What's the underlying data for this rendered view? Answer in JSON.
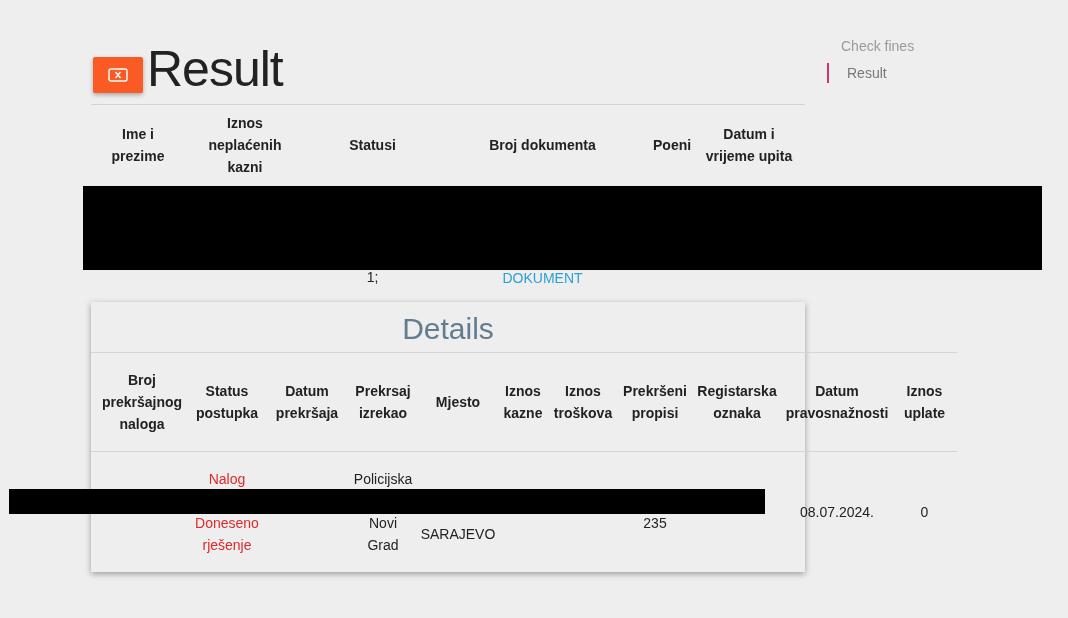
{
  "header": {
    "title": "Result"
  },
  "nav": [
    {
      "label": "Check fines",
      "selected": false
    },
    {
      "label": "Result",
      "selected": true
    }
  ],
  "results_table": {
    "columns": [
      "Ime i prezime",
      "Iznos neplaćenih kazni",
      "Statusi",
      "Broj dokumenta",
      "Poeni",
      "Datum i vrijeme upita"
    ],
    "rows": [
      {
        "cells": [
          {},
          {},
          {
            "lines": [
              {
                "text": "1;",
                "kind": "text"
              }
            ]
          },
          {
            "lines": [
              {
                "text": "DOKUMENT",
                "kind": "link"
              }
            ]
          },
          {},
          {}
        ]
      }
    ]
  },
  "details": {
    "title": "Details",
    "columns": [
      "Broj prekršajnog naloga",
      "Status postupka",
      "Datum prekršaja",
      "Prekrsaj izrekao",
      "Mjesto",
      "Iznos kazne",
      "Iznos troškova",
      "Prekršeni propisi",
      "Registarska oznaka",
      "Datum pravosnažnosti",
      "Iznos uplate"
    ],
    "rows": [
      {
        "cells": [
          {},
          {
            "kind": "status",
            "lines": [
              {
                "text": "Nalog",
                "kind": "text"
              },
              {
                "text": "Doneseno",
                "kind": "text"
              },
              {
                "text": "rješenje",
                "kind": "text"
              }
            ]
          },
          {},
          {
            "kind": "plain",
            "lines": [
              {
                "text": "Policijska",
                "kind": "text"
              },
              {
                "text": "Novi",
                "kind": "text"
              },
              {
                "text": "Grad",
                "kind": "text"
              }
            ]
          },
          {
            "kind": "plain",
            "lines": [
              {
                "text": "SARAJEVO",
                "kind": "text"
              }
            ]
          },
          {},
          {},
          {
            "kind": "plain",
            "lines": [
              {
                "text": "235",
                "kind": "text"
              }
            ]
          },
          {},
          {
            "kind": "plain",
            "lines": [
              {
                "text": "08.07.2024.",
                "kind": "text"
              }
            ]
          },
          {
            "kind": "plain",
            "lines": [
              {
                "text": "0",
                "kind": "text"
              }
            ]
          }
        ]
      }
    ]
  }
}
